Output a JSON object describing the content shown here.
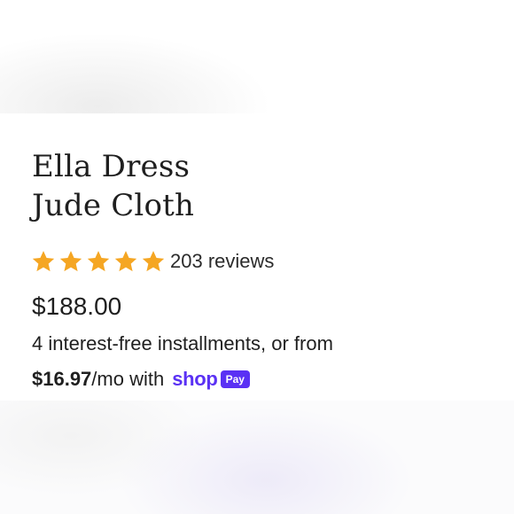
{
  "product": {
    "name_line1": "Ella Dress",
    "name_line2": "Jude Cloth",
    "rating": 5,
    "reviews_label": "203 reviews",
    "price": "$188.00"
  },
  "installments": {
    "text_line1": "4 interest-free installments, or from",
    "monthly_amount": "$16.97",
    "per_month_text": "/mo with",
    "shop_label": "shop",
    "pay_label": "Pay"
  },
  "colors": {
    "star": "#f5a623",
    "shop_pay": "#5a31f4",
    "text": "#1f1f1f"
  },
  "icons": {
    "star": "star-icon"
  }
}
